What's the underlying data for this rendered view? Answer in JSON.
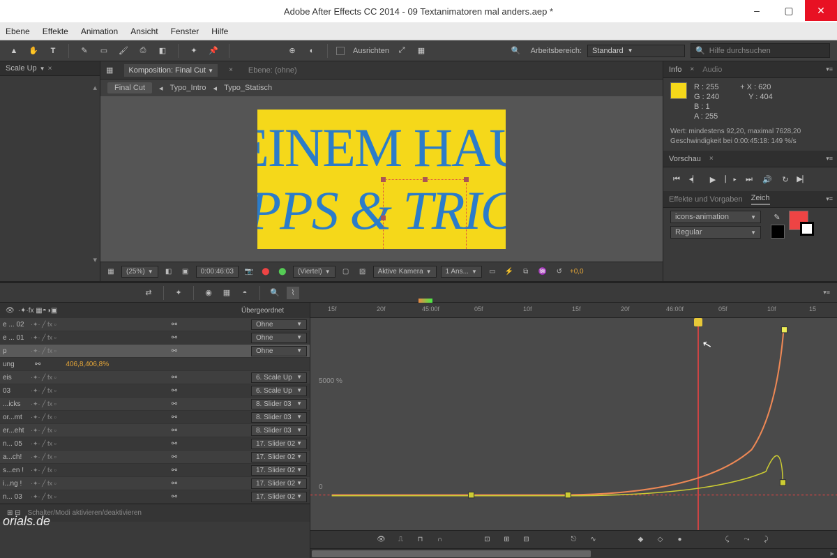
{
  "titlebar": {
    "title": "Adobe After Effects CC 2014 - 09 Textanimatoren mal anders.aep *"
  },
  "menu": {
    "items": [
      "Ebene",
      "Effekte",
      "Animation",
      "Ansicht",
      "Fenster",
      "Hilfe"
    ]
  },
  "toolbar": {
    "ausrichten": "Ausrichten",
    "workspace_label": "Arbeitsbereich:",
    "workspace_value": "Standard",
    "search_placeholder": "Hilfe durchsuchen"
  },
  "left_panel": {
    "tab": "Scale Up"
  },
  "comp_panel": {
    "tab1": "Komposition: Final Cut",
    "tab2": "Ebene: (ohne)",
    "breadcrumbs": [
      "Final Cut",
      "Typo_Intro",
      "Typo_Statisch"
    ],
    "canvas_text1": "EINEM HAU",
    "canvas_text2": "PPS & TRIC"
  },
  "vp_footer": {
    "zoom": "(25%)",
    "timecode": "0:00:46:03",
    "res": "(Viertel)",
    "camera": "Aktive Kamera",
    "views": "1 Ans...",
    "exposure": "+0,0"
  },
  "info": {
    "tab1": "Info",
    "tab2": "Audio",
    "r": "R :    255",
    "g": "G :    240",
    "b": "B :    1",
    "a": "A :    255",
    "x": "X : 620",
    "y": "Y : 404",
    "note1": "Wert: mindestens  92,20, maximal 7628,20",
    "note2": "Geschwindigkeit bei 0:00:45:18:  149 %/s"
  },
  "preview": {
    "tab": "Vorschau"
  },
  "effects": {
    "tab1": "Effekte und Vorgaben",
    "tab2": "Zeich"
  },
  "char": {
    "font": "icons-animation",
    "style": "Regular"
  },
  "timeline": {
    "header_parent": "Übergeordnet",
    "ruler": [
      "15f",
      "20f",
      "45:00f",
      "05f",
      "10f",
      "15f",
      "20f",
      "46:00f",
      "05f",
      "10f",
      "15"
    ],
    "ruler_pos": [
      25,
      95,
      160,
      235,
      305,
      375,
      445,
      510,
      585,
      655,
      715
    ],
    "playhead_indicator": "46:00f",
    "graph_y_max": "5000 %",
    "graph_y_min": "0",
    "layers": [
      {
        "name": "e ... 02",
        "parent": "Ohne",
        "cls": "even"
      },
      {
        "name": "e ... 01",
        "parent": "Ohne",
        "cls": "odd"
      },
      {
        "name": "p",
        "parent": "Ohne",
        "cls": "sel"
      },
      {
        "name": "ung",
        "parent": "",
        "cls": "odd",
        "prop": "406,8,406,8%"
      },
      {
        "name": "eis",
        "parent": "6. Scale Up",
        "cls": "even"
      },
      {
        "name": "03",
        "parent": "6. Scale Up",
        "cls": "odd"
      },
      {
        "name": "...icks",
        "parent": "8. Slider 03",
        "cls": "even"
      },
      {
        "name": "or...mt",
        "parent": "8. Slider 03",
        "cls": "odd"
      },
      {
        "name": "er...eht",
        "parent": "8. Slider 03",
        "cls": "even"
      },
      {
        "name": "n... 05",
        "parent": "17. Slider 02",
        "cls": "odd"
      },
      {
        "name": "a...ch!",
        "parent": "17. Slider 02",
        "cls": "even"
      },
      {
        "name": "s...en !",
        "parent": "17. Slider 02",
        "cls": "odd"
      },
      {
        "name": "i...ng !",
        "parent": "17. Slider 02",
        "cls": "even"
      },
      {
        "name": "n... 03",
        "parent": "17. Slider 02",
        "cls": "odd"
      }
    ],
    "footer_left": "Schalter/Modi aktivieren/deaktivieren",
    "watermark": "orials.de"
  }
}
